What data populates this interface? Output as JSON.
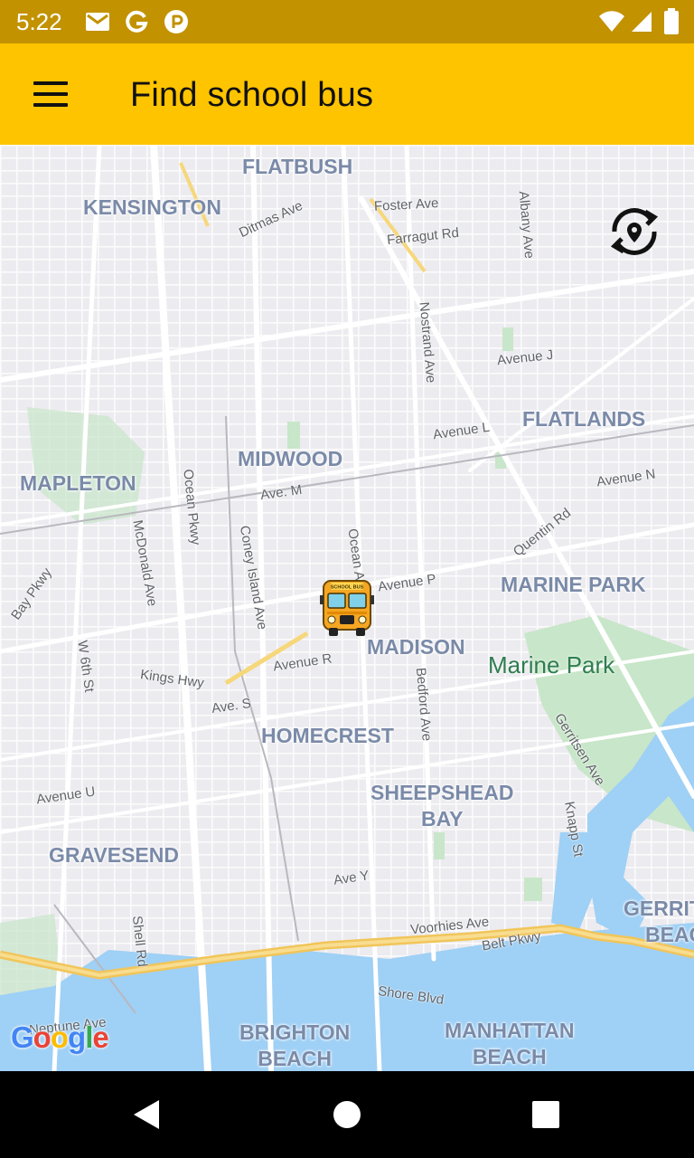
{
  "status": {
    "time": "5:22",
    "left_icons": [
      "gmail-icon",
      "google-icon",
      "app-notification-icon"
    ],
    "right_icons": [
      "wifi-icon",
      "cell-signal-icon",
      "battery-icon"
    ]
  },
  "app_bar": {
    "title": "Find school bus",
    "menu_icon": "menu-icon",
    "color": "#ffc400"
  },
  "map": {
    "neighborhoods": {
      "flatbush": "FLATBUSH",
      "kensington": "KENSINGTON",
      "flatlands": "FLATLANDS",
      "midwood": "MIDWOOD",
      "mapleton": "MAPLETON",
      "marine_park_hood": "MARINE PARK",
      "madison": "MADISON",
      "homecrest": "HOMECREST",
      "sheepshead_1": "SHEEPSHEAD",
      "sheepshead_2": "BAY",
      "gravesend": "GRAVESEND",
      "gerritsen_1": "GERRIT",
      "gerritsen_2": "BEAC",
      "brighton_1": "BRIGHTON",
      "brighton_2": "BEACH",
      "manhattan_1": "MANHATTAN",
      "manhattan_2": "BEACH"
    },
    "streets": {
      "ditmas": "Ditmas Ave",
      "foster": "Foster Ave",
      "farragut": "Farragut Rd",
      "albany": "Albany Ave",
      "nostrand": "Nostrand Ave",
      "avenue_j": "Avenue J",
      "avenue_l": "Avenue L",
      "avenue_m": "Ave. M",
      "avenue_n": "Avenue N",
      "quentin": "Quentin Rd",
      "ocean_pkwy": "Ocean Pkwy",
      "coney": "Coney Island Ave",
      "mcdonald": "McDonald Ave",
      "bay_pkwy": "Bay Pkwy",
      "ocean_ave": "Ocean Av",
      "avenue_p": "Avenue P",
      "w6th": "W 6th St",
      "kings": "Kings Hwy",
      "avenue_r": "Avenue R",
      "bedford": "Bedford Ave",
      "avenue_s": "Ave. S",
      "gerritsen": "Gerritsen Ave",
      "avenue_u": "Avenue U",
      "knapp": "Knapp St",
      "avenue_y": "Ave Y",
      "voorhies": "Voorhies Ave",
      "belt": "Belt Pkwy",
      "shell": "Shell Rd",
      "shore": "Shore Blvd",
      "neptune": "Neptune Ave"
    },
    "park_label": "Marine Park",
    "google_logo": "Google",
    "recenter_icon": "location-refresh-icon",
    "bus_marker_text": "SCHOOL BUS",
    "colors": {
      "land": "#ecebef",
      "water": "#9fd0f5",
      "park": "#c8e6c9",
      "highway": "#f6cf65"
    }
  },
  "nav": {
    "back_icon": "back-icon",
    "home_icon": "home-icon",
    "recents_icon": "recents-icon"
  }
}
